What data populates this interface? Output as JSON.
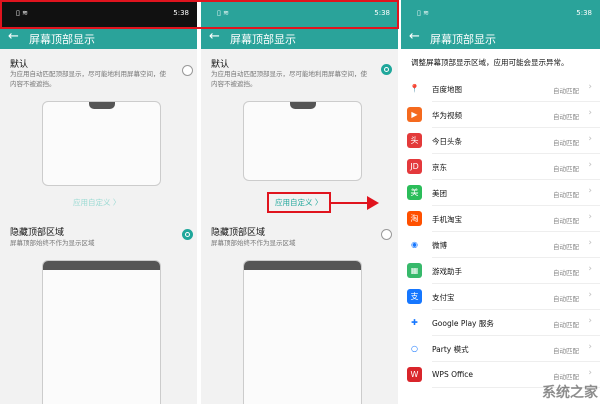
{
  "status": {
    "time": "5:38",
    "battery": "86"
  },
  "title": "屏幕顶部显示",
  "options": {
    "default_title": "默认",
    "default_desc": "为应用自动匹配顶部显示，尽可能地利用屏幕空间，使内容不被遮挡。",
    "hide_title": "隐藏顶部区域",
    "hide_desc": "屏幕顶部始终不作为显示区域"
  },
  "custom_link": "应用自定义 〉",
  "list_header": "调整屏幕顶部显示区域，应用可能会显示异常。",
  "apps": [
    {
      "name": "百度地图",
      "mode": "自动匹配",
      "icon": "map-pin-icon",
      "color": "#ffffff",
      "glyph": "📍"
    },
    {
      "name": "华为视频",
      "mode": "自动匹配",
      "icon": "play-icon",
      "color": "#f56a1e",
      "glyph": "▶"
    },
    {
      "name": "今日头条",
      "mode": "自动匹配",
      "icon": "toutiao-icon",
      "color": "#e33a3a",
      "glyph": "头条"
    },
    {
      "name": "京东",
      "mode": "自动匹配",
      "icon": "jd-icon",
      "color": "#e4393c",
      "glyph": "JD"
    },
    {
      "name": "美团",
      "mode": "自动匹配",
      "icon": "meituan-icon",
      "color": "#2bbd5a",
      "glyph": "美团"
    },
    {
      "name": "手机淘宝",
      "mode": "自动匹配",
      "icon": "taobao-icon",
      "color": "#ff5000",
      "glyph": "淘"
    },
    {
      "name": "微博",
      "mode": "自动匹配",
      "icon": "weibo-icon",
      "color": "#ffffff",
      "glyph": "◉"
    },
    {
      "name": "游戏助手",
      "mode": "自动匹配",
      "icon": "game-icon",
      "color": "#37b96b",
      "glyph": "▦"
    },
    {
      "name": "支付宝",
      "mode": "自动匹配",
      "icon": "alipay-icon",
      "color": "#1677ff",
      "glyph": "支"
    },
    {
      "name": "Google Play 服务",
      "mode": "自动匹配",
      "icon": "puzzle-icon",
      "color": "#ffffff",
      "glyph": "✚"
    },
    {
      "name": "Party 模式",
      "mode": "自动匹配",
      "icon": "party-icon",
      "color": "#ffffff",
      "glyph": "○"
    },
    {
      "name": "WPS Office",
      "mode": "自动匹配",
      "icon": "wps-icon",
      "color": "#d9252b",
      "glyph": "W"
    }
  ],
  "watermark": "系统之家"
}
